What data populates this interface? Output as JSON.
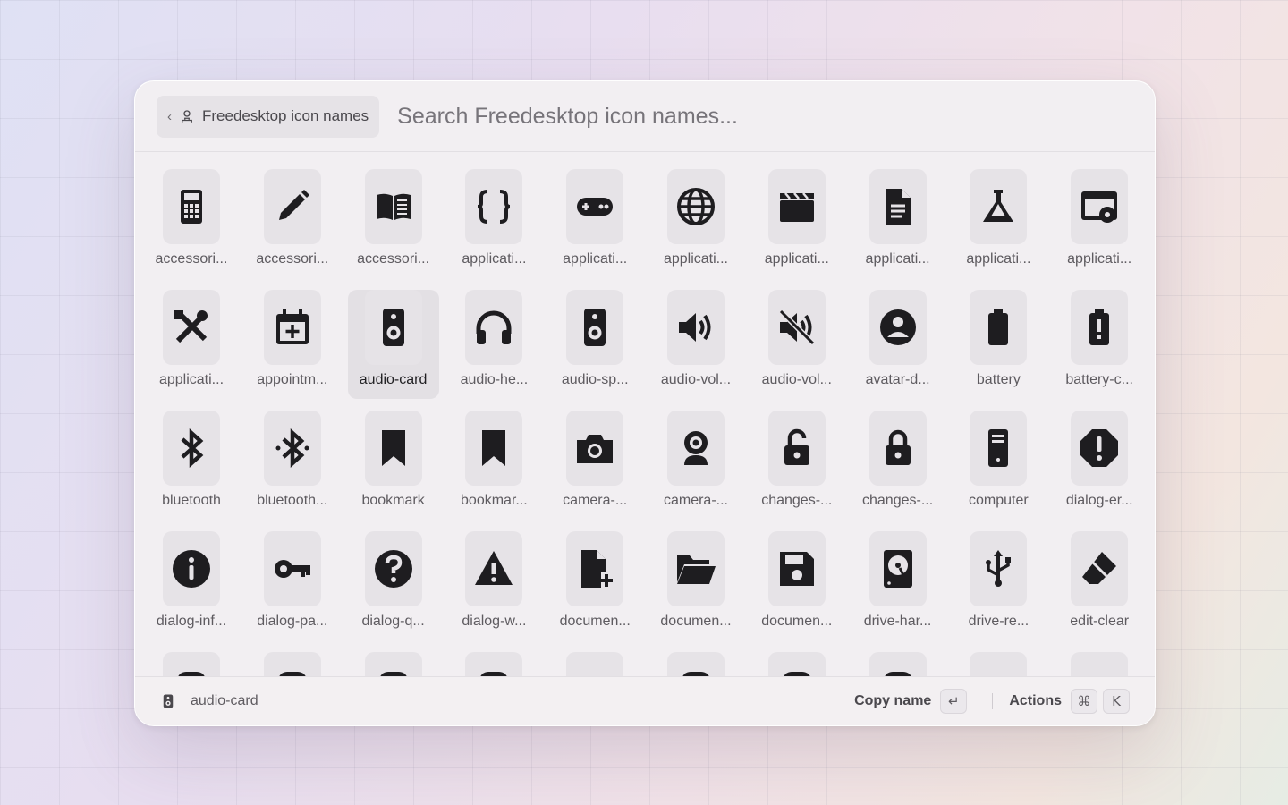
{
  "header": {
    "breadcrumb_back": "‹",
    "breadcrumb_label": "Freedesktop icon names",
    "search_placeholder": "Search Freedesktop icon names..."
  },
  "icons": [
    {
      "label": "accessori...",
      "icon": "calculator-icon"
    },
    {
      "label": "accessori...",
      "icon": "pencil-icon"
    },
    {
      "label": "accessori...",
      "icon": "book-icon"
    },
    {
      "label": "applicati...",
      "icon": "braces-icon"
    },
    {
      "label": "applicati...",
      "icon": "gamepad-icon"
    },
    {
      "label": "applicati...",
      "icon": "globe-icon"
    },
    {
      "label": "applicati...",
      "icon": "clapperboard-icon"
    },
    {
      "label": "applicati...",
      "icon": "document-icon"
    },
    {
      "label": "applicati...",
      "icon": "flask-icon"
    },
    {
      "label": "applicati...",
      "icon": "window-gear-icon"
    },
    {
      "label": "applicati...",
      "icon": "tools-icon"
    },
    {
      "label": "appointm...",
      "icon": "calendar-plus-icon"
    },
    {
      "label": "audio-card",
      "icon": "speaker-icon",
      "selected": true
    },
    {
      "label": "audio-he...",
      "icon": "headphones-icon"
    },
    {
      "label": "audio-sp...",
      "icon": "speaker-icon"
    },
    {
      "label": "audio-vol...",
      "icon": "volume-high-icon"
    },
    {
      "label": "audio-vol...",
      "icon": "volume-mute-icon"
    },
    {
      "label": "avatar-d...",
      "icon": "user-circle-icon"
    },
    {
      "label": "battery",
      "icon": "battery-icon"
    },
    {
      "label": "battery-c...",
      "icon": "battery-caution-icon"
    },
    {
      "label": "bluetooth",
      "icon": "bluetooth-icon"
    },
    {
      "label": "bluetooth...",
      "icon": "bluetooth-active-icon"
    },
    {
      "label": "bookmark",
      "icon": "bookmark-icon"
    },
    {
      "label": "bookmar...",
      "icon": "bookmark-icon"
    },
    {
      "label": "camera-...",
      "icon": "camera-icon"
    },
    {
      "label": "camera-...",
      "icon": "webcam-icon"
    },
    {
      "label": "changes-...",
      "icon": "unlock-icon"
    },
    {
      "label": "changes-...",
      "icon": "lock-icon"
    },
    {
      "label": "computer",
      "icon": "computer-icon"
    },
    {
      "label": "dialog-er...",
      "icon": "error-icon"
    },
    {
      "label": "dialog-inf...",
      "icon": "info-icon"
    },
    {
      "label": "dialog-pa...",
      "icon": "key-icon"
    },
    {
      "label": "dialog-q...",
      "icon": "question-icon"
    },
    {
      "label": "dialog-w...",
      "icon": "warning-icon"
    },
    {
      "label": "documen...",
      "icon": "document-new-icon"
    },
    {
      "label": "documen...",
      "icon": "folder-open-icon"
    },
    {
      "label": "documen...",
      "icon": "save-icon"
    },
    {
      "label": "drive-har...",
      "icon": "harddisk-icon"
    },
    {
      "label": "drive-re...",
      "icon": "usb-icon"
    },
    {
      "label": "edit-clear",
      "icon": "eraser-icon"
    }
  ],
  "footer": {
    "selected_name": "audio-card",
    "primary_action": "Copy name",
    "primary_key": "↵",
    "secondary_action": "Actions",
    "secondary_key_1": "⌘",
    "secondary_key_2": "K"
  }
}
